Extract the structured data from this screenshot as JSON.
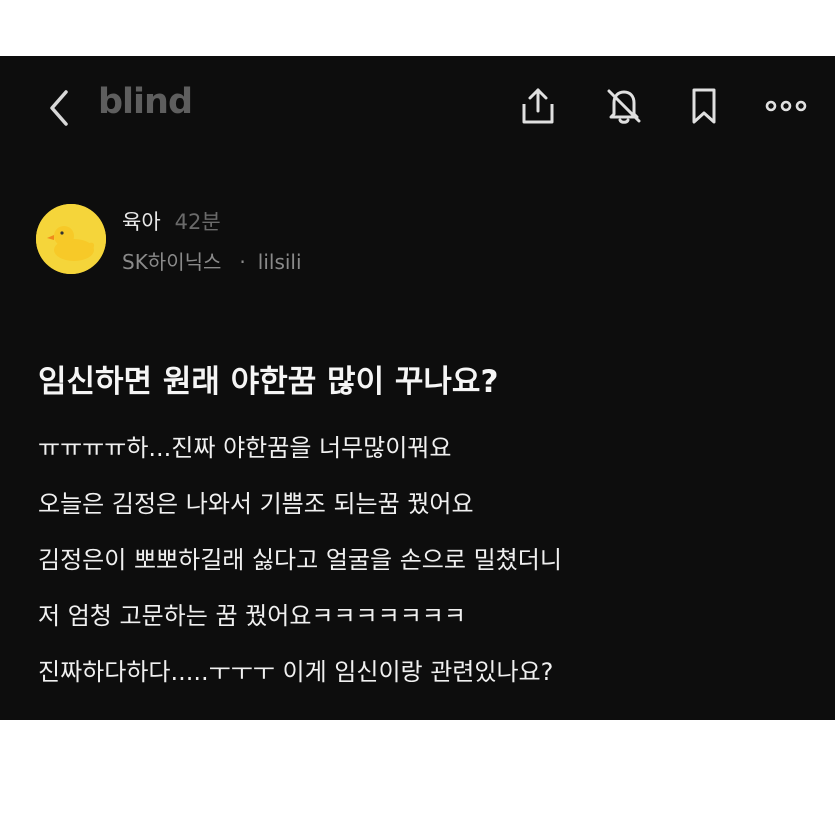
{
  "app": {
    "logo": "blind"
  },
  "icons": {
    "back": "chevron-left-icon",
    "share": "share-icon",
    "notifications": "bell-off-icon",
    "bookmark": "bookmark-icon",
    "more": "more-horizontal-icon",
    "avatar": "rubber-duck-avatar"
  },
  "author": {
    "board": "육아",
    "time": "42분",
    "company": "SK하이닉스",
    "separator": "·",
    "nickname": "lilsili"
  },
  "post": {
    "title": "임신하면 원래 야한꿈 많이 꾸나요?",
    "lines": [
      "ㅠㅠㅠㅠ하...진짜 야한꿈을 너무많이꿔요",
      "오늘은 김정은 나와서 기쁨조 되는꿈 꿨어요",
      "김정은이 뽀뽀하길래 싫다고 얼굴을 손으로 밀쳤더니",
      "저 엄청 고문하는 꿈 꿨어요ㅋㅋㅋㅋㅋㅋㅋ",
      "진짜하다하다.....ㅜㅜㅜ 이게 임신이랑 관련있나요?"
    ]
  },
  "colors": {
    "background": "#0d0d0d",
    "text": "#f2f2f2",
    "muted": "#8a8a8a",
    "logo": "#5e5e5e",
    "avatar": "#f5d53a"
  }
}
